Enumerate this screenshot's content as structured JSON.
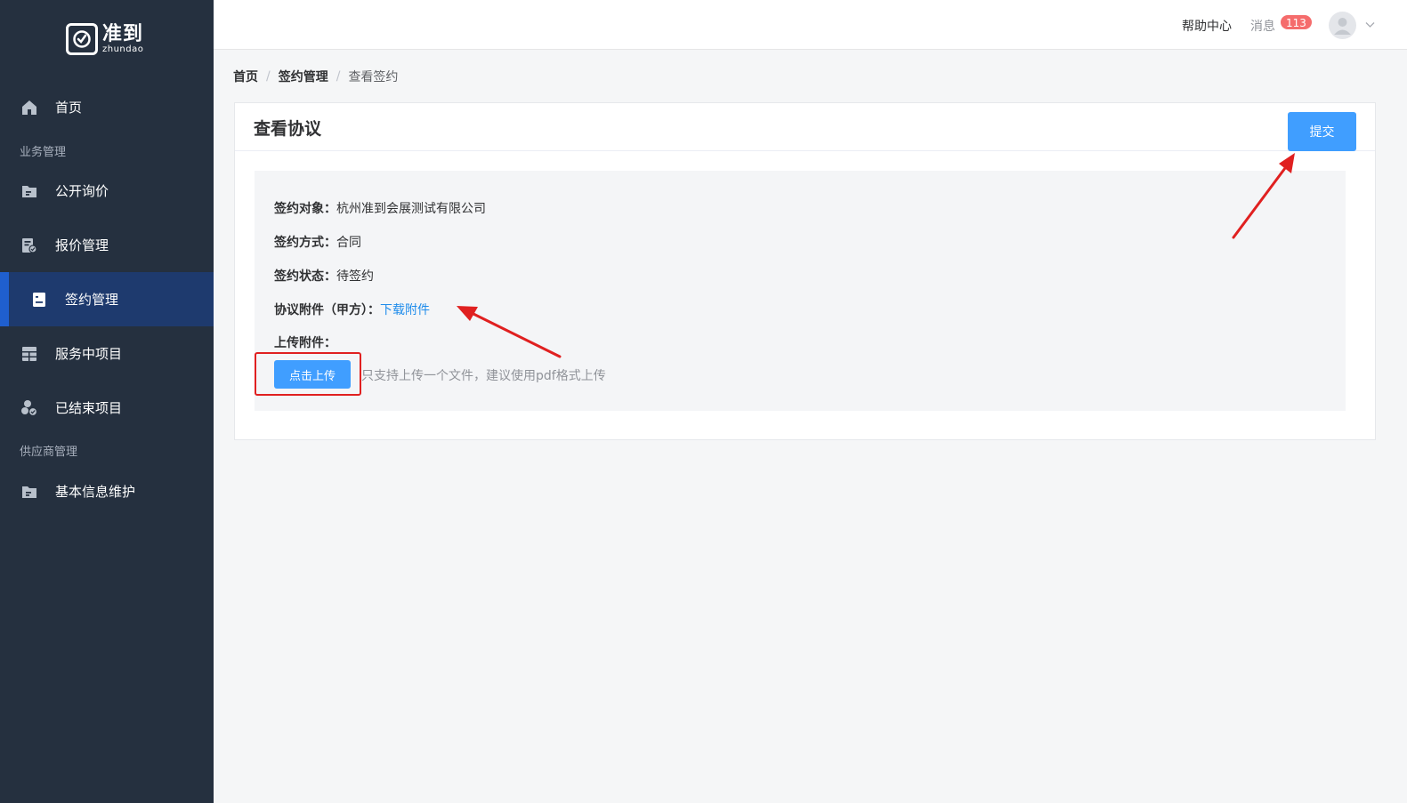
{
  "logo": {
    "cn": "准到",
    "en": "zhundao"
  },
  "sidebar": {
    "items": [
      {
        "label": "首页",
        "icon": "home-icon"
      },
      {
        "label": "公开询价",
        "icon": "folder-icon"
      },
      {
        "label": "报价管理",
        "icon": "quote-icon"
      },
      {
        "label": "签约管理",
        "icon": "contract-icon",
        "active": true
      },
      {
        "label": "服务中项目",
        "icon": "grid-icon"
      },
      {
        "label": "已结束项目",
        "icon": "finished-icon"
      },
      {
        "label": "基本信息维护",
        "icon": "folder-icon"
      }
    ],
    "sections": [
      "业务管理",
      "供应商管理"
    ]
  },
  "header": {
    "help": "帮助中心",
    "messages": "消息",
    "badge": "113"
  },
  "breadcrumb": [
    "首页",
    "签约管理",
    "查看签约"
  ],
  "card": {
    "title": "查看协议",
    "submit_label": "提交",
    "fields": [
      {
        "label": "签约对象：",
        "value": "杭州准到会展测试有限公司"
      },
      {
        "label": "签约方式：",
        "value": "合同"
      },
      {
        "label": "签约状态：",
        "value": "待签约"
      }
    ],
    "attachment_label": "协议附件（甲方）：",
    "download_link": "下载附件",
    "upload_label": "上传附件：",
    "upload_button": "点击上传",
    "upload_tip": "只支持上传一个文件，建议使用pdf格式上传"
  },
  "colors": {
    "sidebar": "#25303f",
    "active": "#1e3a6e",
    "primary": "#409eff",
    "annotation": "#e02020"
  }
}
